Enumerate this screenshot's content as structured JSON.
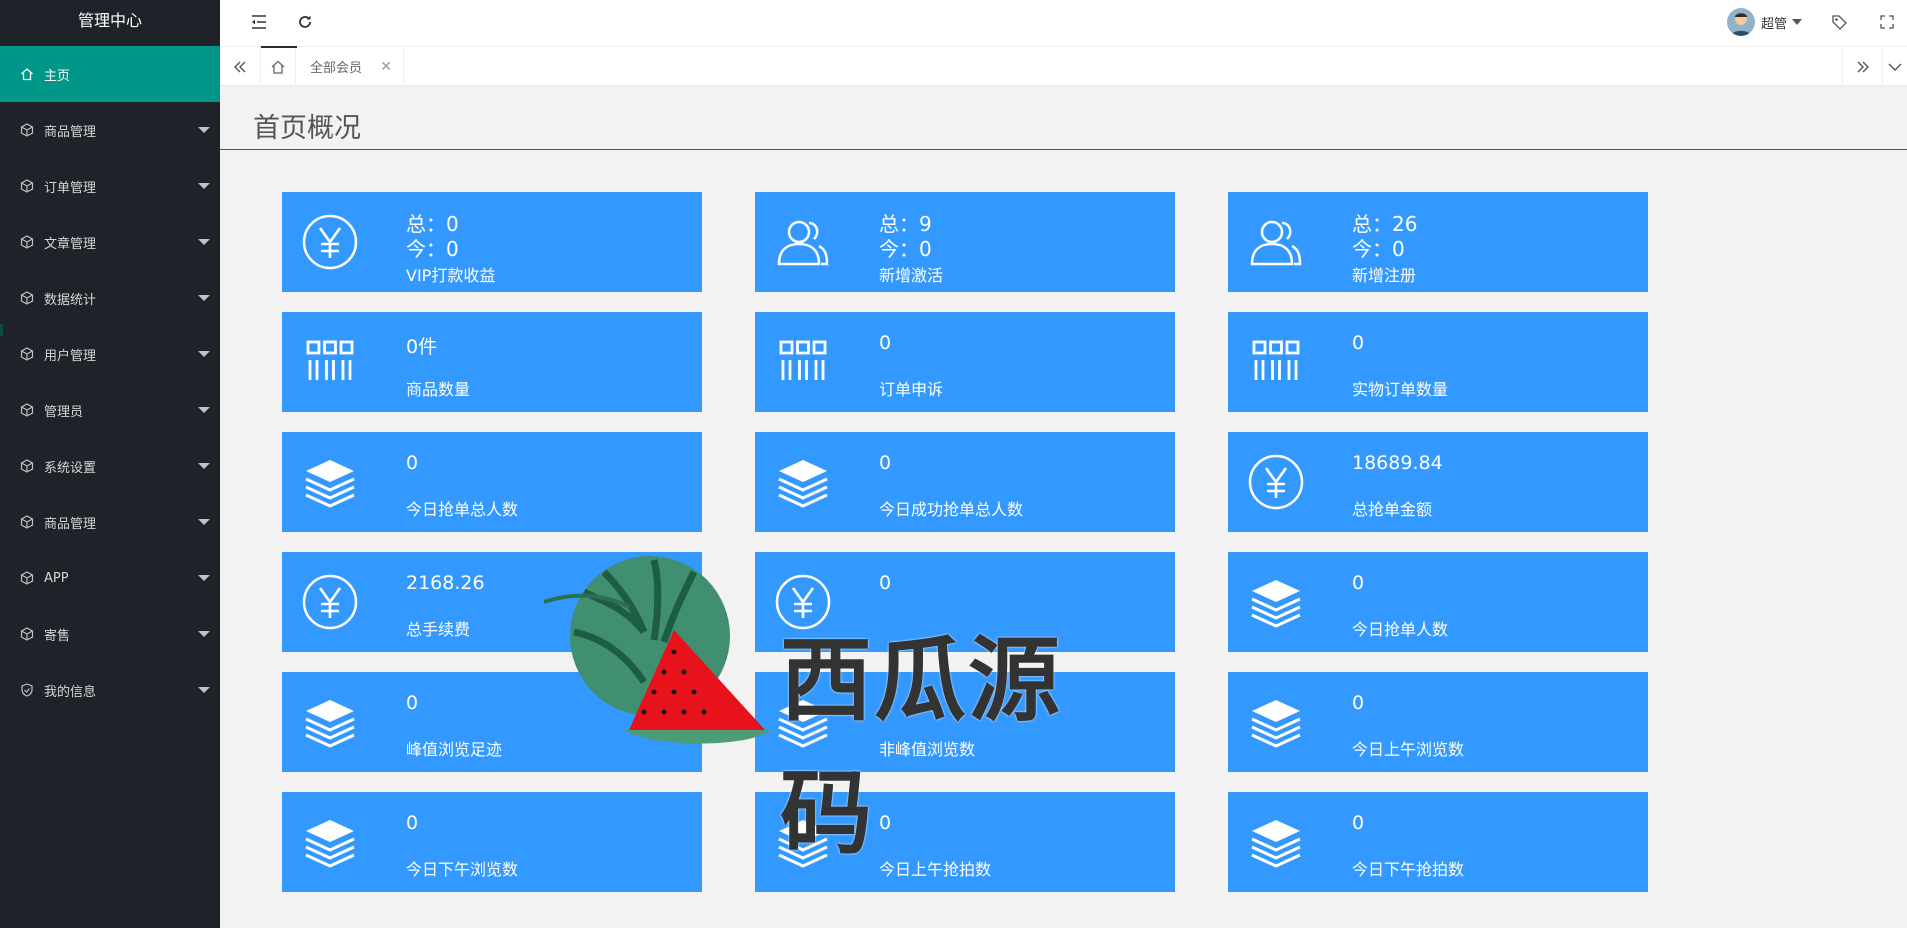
{
  "sidebar": {
    "logo": "管理中心",
    "items": [
      {
        "label": "主页",
        "icon": "home-icon",
        "active": true
      },
      {
        "label": "商品管理",
        "icon": "cube-icon"
      },
      {
        "label": "订单管理",
        "icon": "cube-icon"
      },
      {
        "label": "文章管理",
        "icon": "cube-icon"
      },
      {
        "label": "数据统计",
        "icon": "cube-icon"
      },
      {
        "label": "用户管理",
        "icon": "cube-icon"
      },
      {
        "label": "管理员",
        "icon": "cube-icon"
      },
      {
        "label": "系统设置",
        "icon": "cube-icon"
      },
      {
        "label": "商品管理",
        "icon": "cube-icon"
      },
      {
        "label": "APP",
        "icon": "cube-icon"
      },
      {
        "label": "寄售",
        "icon": "cube-icon"
      },
      {
        "label": "我的信息",
        "icon": "shield-check-icon"
      }
    ]
  },
  "topbar": {
    "user_name": "超管"
  },
  "tabs": {
    "open": [
      {
        "label": "全部会员"
      }
    ]
  },
  "page": {
    "title": "首页概况"
  },
  "cards": [
    {
      "icon": "yen-icon",
      "total": "总：0",
      "today": "今：0",
      "label": "VIP打款收益"
    },
    {
      "icon": "users-icon",
      "total": "总：9",
      "today": "今：0",
      "label": "新增激活"
    },
    {
      "icon": "users-icon",
      "total": "总：26",
      "today": "今：0",
      "label": "新增注册"
    },
    {
      "icon": "grid-icon",
      "value": "0件",
      "label": "商品数量"
    },
    {
      "icon": "grid-icon",
      "value": "0",
      "label": "订单申诉"
    },
    {
      "icon": "grid-icon",
      "value": "0",
      "label": "实物订单数量"
    },
    {
      "icon": "layers-icon",
      "value": "0",
      "label": "今日抢单总人数"
    },
    {
      "icon": "layers-icon",
      "value": "0",
      "label": "今日成功抢单总人数"
    },
    {
      "icon": "yen-icon",
      "value": "18689.84",
      "label": "总抢单金额"
    },
    {
      "icon": "yen-icon",
      "value": "2168.26",
      "label": "总手续费"
    },
    {
      "icon": "yen-icon",
      "value": "0",
      "label": ""
    },
    {
      "icon": "layers-icon",
      "value": "0",
      "label": "今日抢单人数"
    },
    {
      "icon": "layers-icon",
      "value": "0",
      "label": "峰值浏览足迹"
    },
    {
      "icon": "layers-icon",
      "value": "",
      "label": "非峰值浏览数"
    },
    {
      "icon": "layers-icon",
      "value": "0",
      "label": "今日上午浏览数"
    },
    {
      "icon": "layers-icon",
      "value": "0",
      "label": "今日下午浏览数"
    },
    {
      "icon": "layers-icon",
      "value": "0",
      "label": "今日上午抢拍数"
    },
    {
      "icon": "layers-icon",
      "value": "0",
      "label": "今日下午抢拍数"
    }
  ],
  "watermark": {
    "text": "西瓜源码"
  },
  "colors": {
    "sidebar_bg": "#20222a",
    "active": "#009688",
    "card": "#3399ff"
  }
}
